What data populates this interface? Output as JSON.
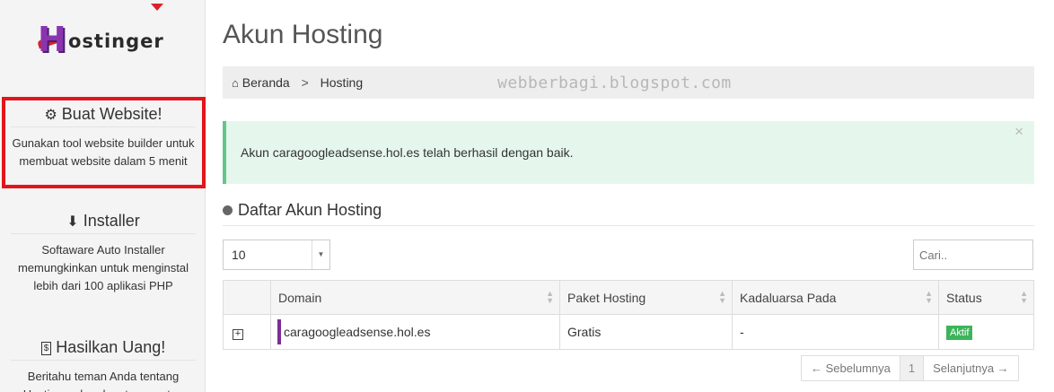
{
  "brand": {
    "logo_text": "Hostinger"
  },
  "sidebar": {
    "promos": [
      {
        "icon": "gears-icon",
        "title": "Buat Website!",
        "text": "Gunakan tool website builder untuk membuat website dalam 5 menit"
      },
      {
        "icon": "download-icon",
        "title": "Installer",
        "text": "Softaware Auto Installer memungkinkan untuk menginstal lebih dari 100 aplikasi PHP"
      },
      {
        "icon": "money-icon",
        "title": "Hasilkan Uang!",
        "text": "Beritahu teman Anda tentang Hostinger dan dapat uang atau"
      }
    ],
    "highlight_color": "#e1151a"
  },
  "main": {
    "title": "Akun Hosting",
    "breadcrumb": {
      "home": "Beranda",
      "current": "Hosting"
    },
    "watermark": "webberbagi.blogspot.com",
    "alert": {
      "message": "Akun caragoogleadsense.hol.es telah berhasil dengan baik.",
      "close": "×",
      "color": "#e5f7ec"
    },
    "section_title": "Daftar Akun Hosting",
    "page_length": "10",
    "search_placeholder": "Cari..",
    "table": {
      "columns": [
        "Domain",
        "Paket Hosting",
        "Kadaluarsa Pada",
        "Status"
      ],
      "rows": [
        {
          "domain": "caragoogleadsense.hol.es",
          "paket": "Gratis",
          "kadaluarsa": "-",
          "status": "Aktif"
        }
      ]
    },
    "pagination": {
      "prev": "← Sebelumnya",
      "current": "1",
      "next": "Selanjutnya →"
    },
    "colors": {
      "accent": "#7b2f96",
      "status_active": "#3cb55a"
    }
  }
}
